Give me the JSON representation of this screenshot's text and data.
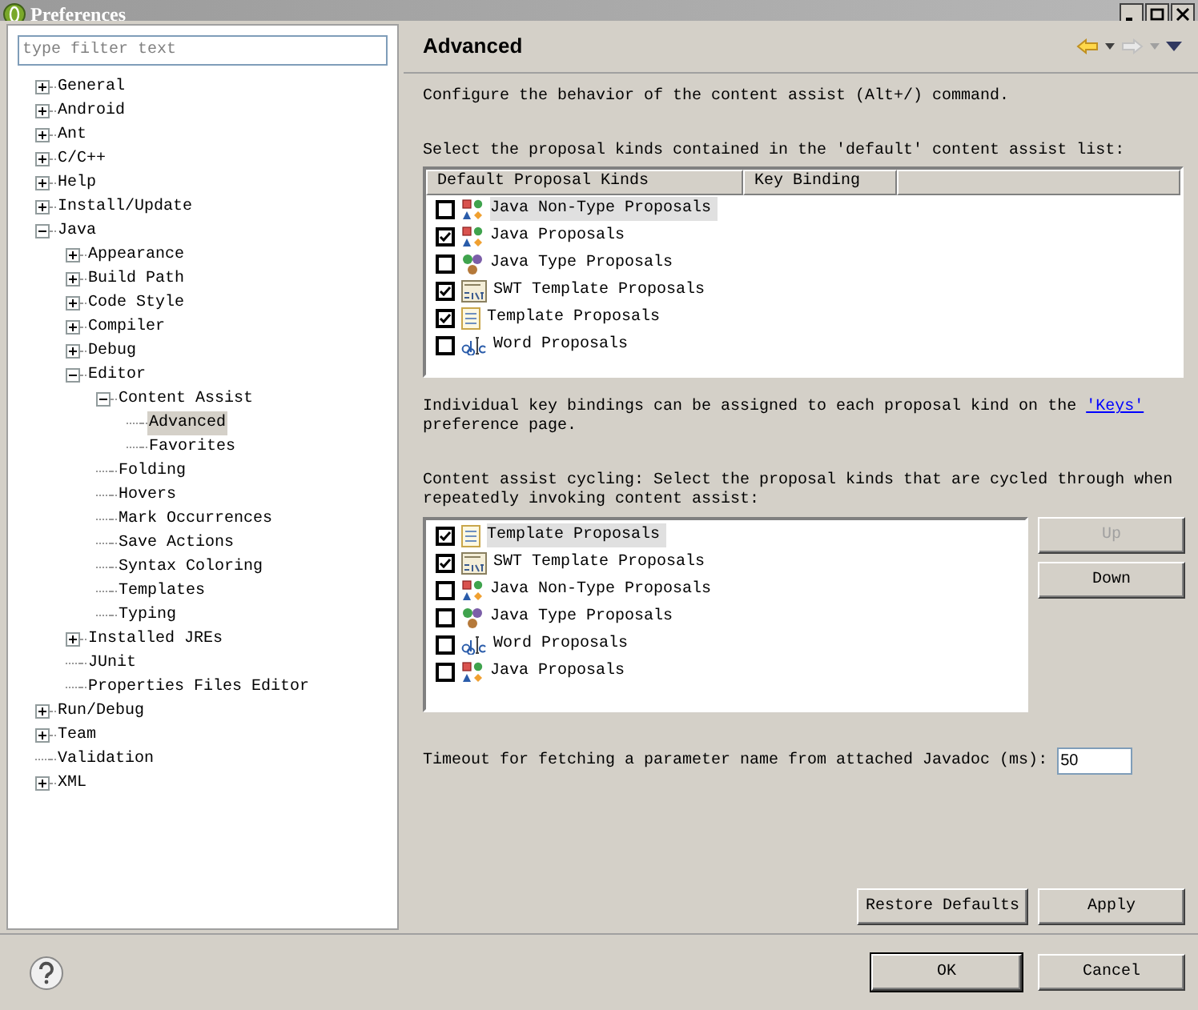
{
  "window": {
    "title": "Preferences"
  },
  "filter": {
    "placeholder": "type filter text"
  },
  "tree": [
    {
      "label": "General",
      "expanded": false,
      "selected": false
    },
    {
      "label": "Android",
      "expanded": false,
      "selected": false
    },
    {
      "label": "Ant",
      "expanded": false,
      "selected": false
    },
    {
      "label": "C/C++",
      "expanded": false,
      "selected": false
    },
    {
      "label": "Help",
      "expanded": false,
      "selected": false
    },
    {
      "label": "Install/Update",
      "expanded": false,
      "selected": false
    },
    {
      "label": "Java",
      "expanded": true,
      "selected": false,
      "children": [
        {
          "label": "Appearance",
          "expanded": false,
          "selected": false
        },
        {
          "label": "Build Path",
          "expanded": false,
          "selected": false
        },
        {
          "label": "Code Style",
          "expanded": false,
          "selected": false
        },
        {
          "label": "Compiler",
          "expanded": false,
          "selected": false
        },
        {
          "label": "Debug",
          "expanded": false,
          "selected": false
        },
        {
          "label": "Editor",
          "expanded": true,
          "selected": false,
          "children": [
            {
              "label": "Content Assist",
              "expanded": true,
              "selected": false,
              "children": [
                {
                  "label": "Advanced",
                  "selected": true
                },
                {
                  "label": "Favorites",
                  "selected": false
                }
              ]
            },
            {
              "label": "Folding",
              "selected": false
            },
            {
              "label": "Hovers",
              "selected": false
            },
            {
              "label": "Mark Occurrences",
              "selected": false
            },
            {
              "label": "Save Actions",
              "selected": false
            },
            {
              "label": "Syntax Coloring",
              "selected": false
            },
            {
              "label": "Templates",
              "selected": false
            },
            {
              "label": "Typing",
              "selected": false
            }
          ]
        },
        {
          "label": "Installed JREs",
          "expanded": false,
          "selected": false
        },
        {
          "label": "JUnit",
          "selected": false
        },
        {
          "label": "Properties Files Editor",
          "selected": false
        }
      ]
    },
    {
      "label": "Run/Debug",
      "expanded": false,
      "selected": false
    },
    {
      "label": "Team",
      "expanded": false,
      "selected": false
    },
    {
      "label": "Validation",
      "selected": false
    },
    {
      "label": "XML",
      "expanded": false,
      "selected": false
    }
  ],
  "page": {
    "title": "Advanced",
    "forward_enabled": false,
    "description": "Configure the behavior of the content assist (Alt+/) command.",
    "default_list_label": "Select the proposal kinds contained in the 'default' content assist list:",
    "default_table": {
      "columns": [
        "Default Proposal Kinds",
        "Key Binding"
      ],
      "rows": [
        {
          "kind": "java",
          "label": "Java Non-Type Proposals",
          "checked": false,
          "selected": true
        },
        {
          "kind": "java",
          "label": "Java Proposals",
          "checked": true,
          "selected": false
        },
        {
          "kind": "type",
          "label": "Java Type Proposals",
          "checked": false,
          "selected": false
        },
        {
          "kind": "swt",
          "label": "SWT Template Proposals",
          "checked": true,
          "selected": false
        },
        {
          "kind": "template",
          "label": "Template Proposals",
          "checked": true,
          "selected": false
        },
        {
          "kind": "word",
          "label": "Word Proposals",
          "checked": false,
          "selected": false
        }
      ]
    },
    "keys_note": "Individual key bindings can be assigned to each proposal kind on the",
    "keys_link": "'Keys'",
    "keys_note_end": "preference page.",
    "cycling_label": "Content assist cycling: Select the proposal kinds that are cycled through when repeatedly invoking content assist:",
    "cycling_list": [
      {
        "kind": "template",
        "label": "Template Proposals",
        "checked": true,
        "selected": true
      },
      {
        "kind": "swt",
        "label": "SWT Template Proposals",
        "checked": true,
        "selected": false
      },
      {
        "kind": "java",
        "label": "Java Non-Type Proposals",
        "checked": false,
        "selected": false
      },
      {
        "kind": "type",
        "label": "Java Type Proposals",
        "checked": false,
        "selected": false
      },
      {
        "kind": "word",
        "label": "Word Proposals",
        "checked": false,
        "selected": false
      },
      {
        "kind": "java",
        "label": "Java Proposals",
        "checked": false,
        "selected": false
      }
    ],
    "up_button": {
      "label": "Up",
      "disabled": true
    },
    "down_button": {
      "label": "Down",
      "disabled": false
    },
    "timeout": {
      "label": "Timeout for fetching a parameter name from attached Javadoc (ms):",
      "value": "50"
    },
    "restore_button": "Restore Defaults",
    "apply_button": "Apply"
  },
  "buttons": {
    "ok": "OK",
    "cancel": "Cancel"
  }
}
